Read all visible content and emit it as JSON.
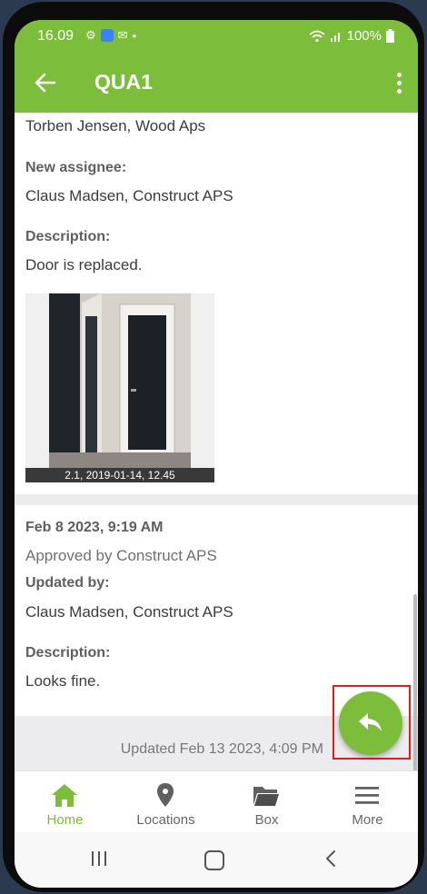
{
  "status": {
    "time": "16.09",
    "battery": "100%"
  },
  "appbar": {
    "title": "QUA1"
  },
  "entry1": {
    "line1": "Torben Jensen, Wood Aps",
    "new_assignee_label": "New assignee:",
    "new_assignee_value": "Claus Madsen, Construct APS",
    "description_label": "Description:",
    "description_value": "Door is replaced.",
    "photo_caption": "2.1, 2019-01-14, 12.45"
  },
  "entry2": {
    "date": "Feb 8 2023, 9:19 AM",
    "status": "Approved by Construct APS",
    "updated_by_label": "Updated by:",
    "updated_by_value": "Claus Madsen, Construct APS",
    "description_label": "Description:",
    "description_value": "Looks fine."
  },
  "footer": {
    "updated": "Updated Feb 13 2023, 4:09 PM"
  },
  "nav": [
    {
      "label": "Home",
      "icon": "home-icon"
    },
    {
      "label": "Locations",
      "icon": "location-pin-icon"
    },
    {
      "label": "Box",
      "icon": "folder-icon"
    },
    {
      "label": "More",
      "icon": "hamburger-menu-icon"
    }
  ],
  "colors": {
    "accent": "#7cbd3b",
    "highlight": "#e01e1e"
  }
}
